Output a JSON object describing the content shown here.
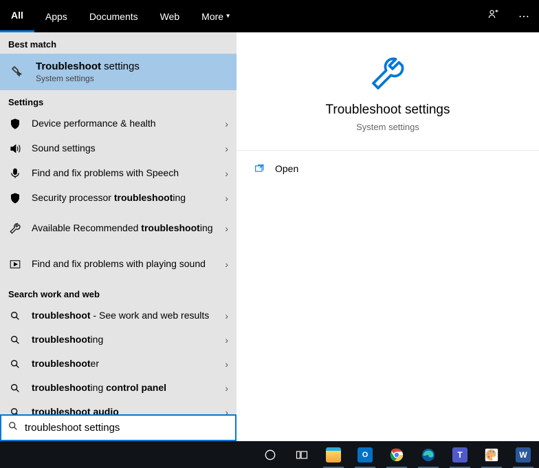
{
  "tabs": {
    "all": "All",
    "apps": "Apps",
    "documents": "Documents",
    "web": "Web",
    "more": "More"
  },
  "section": {
    "best_match": "Best match",
    "settings": "Settings",
    "search_work_web": "Search work and web"
  },
  "best": {
    "title_strong": "Troubleshoot",
    "title_rest": " settings",
    "subtitle": "System settings"
  },
  "settings_items": [
    {
      "label_html": "Device performance & health",
      "icon": "shield"
    },
    {
      "label_html": "Sound settings",
      "icon": "sound"
    },
    {
      "label_html": "Find and fix problems with Speech",
      "icon": "mic"
    },
    {
      "label_html": "Security processor <strong>troubleshoot</strong>ing",
      "icon": "shield"
    },
    {
      "label_html": "Available Recommended <strong>troubleshoot</strong>ing",
      "icon": "wrench",
      "tall": true
    },
    {
      "label_html": "Find and fix problems with playing sound",
      "icon": "play",
      "tall": true
    }
  ],
  "suggestions": [
    {
      "label_html": "<strong>troubleshoot</strong> - See work and web results"
    },
    {
      "label_html": "<strong>troubleshoot</strong>ing"
    },
    {
      "label_html": "<strong>troubleshoot</strong>er"
    },
    {
      "label_html": "<strong>troubleshoot</strong>ing <strong>control panel</strong>"
    },
    {
      "label_html": "<strong>troubleshoot</strong> <strong>audio</strong>"
    }
  ],
  "detail": {
    "title": "Troubleshoot settings",
    "subtitle": "System settings",
    "open": "Open"
  },
  "search": {
    "query": "troubleshoot settings"
  },
  "colors": {
    "accent": "#0078d4"
  }
}
